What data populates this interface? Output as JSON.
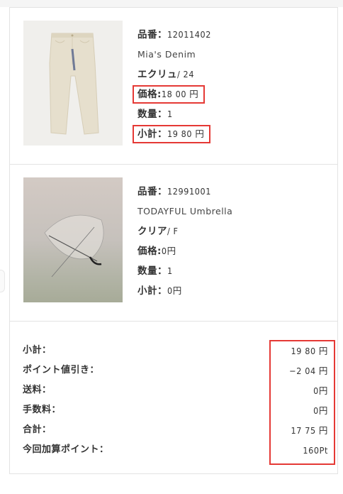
{
  "items": [
    {
      "code_label": "品番：",
      "code": "12011402",
      "name": "Mia's Denim",
      "variant_color": "エクリュ",
      "variant_size": "/ 24",
      "price_label": "価格:",
      "price": "18 00 円",
      "qty_label": "数量：",
      "qty": "1",
      "subtotal_label": "小計：",
      "subtotal": "19 80 円"
    },
    {
      "code_label": "品番：",
      "code": "12991001",
      "name": "TODAYFUL Umbrella",
      "variant_color": "クリア",
      "variant_size": "/ F",
      "price_label": "価格:",
      "price": "0円",
      "qty_label": "数量：",
      "qty": "1",
      "subtotal_label": "小計：",
      "subtotal": "0円"
    }
  ],
  "summary": {
    "labels": [
      "小計：",
      "ポイント値引き：",
      "送料：",
      "手数料：",
      "合計：",
      "今回加算ポイント："
    ],
    "values": [
      "19 80 円",
      "−2 04 円",
      "0円",
      "0円",
      "17 75 円",
      "160Pt"
    ]
  },
  "colors": {
    "highlight": "#e53935",
    "border": "#e3e3e3"
  }
}
